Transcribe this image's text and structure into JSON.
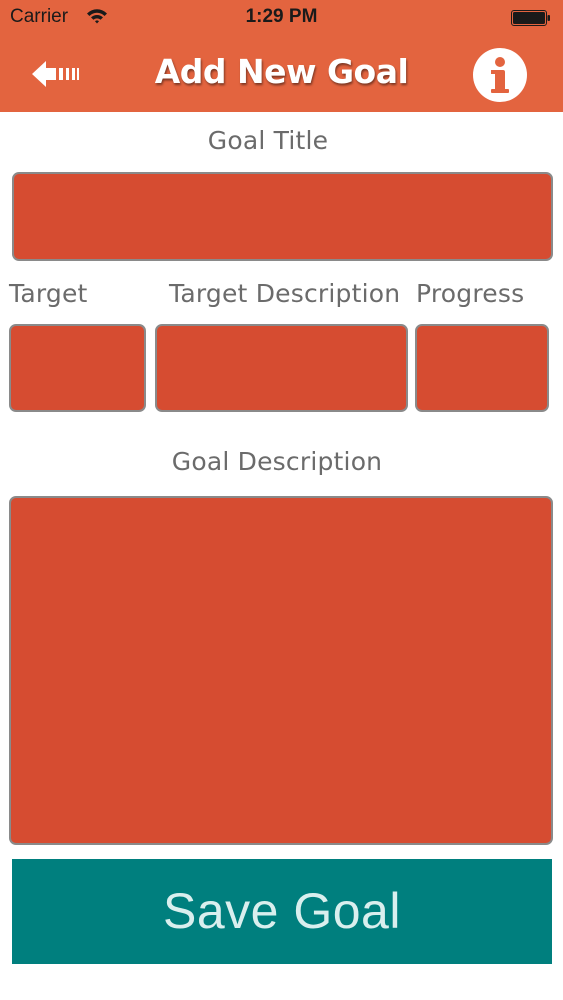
{
  "status_bar": {
    "carrier": "Carrier",
    "time": "1:29 PM"
  },
  "nav": {
    "title": "Add New Goal",
    "back_icon": "back-arrow-icon",
    "info_icon": "info-icon"
  },
  "form": {
    "goal_title_label": "Goal Title",
    "goal_title_value": "",
    "target_label": "Target",
    "target_value": "",
    "target_description_label": "Target Description",
    "target_description_value": "",
    "progress_label": "Progress",
    "progress_value": "",
    "goal_description_label": "Goal Description",
    "goal_description_value": ""
  },
  "save_button": {
    "label": "Save Goal"
  },
  "colors": {
    "nav_bar": "#E3643F",
    "field_fill": "#D64C31",
    "field_border": "#8a8a8a",
    "save_button": "#007F7E",
    "label_text": "#6b6b6b"
  }
}
